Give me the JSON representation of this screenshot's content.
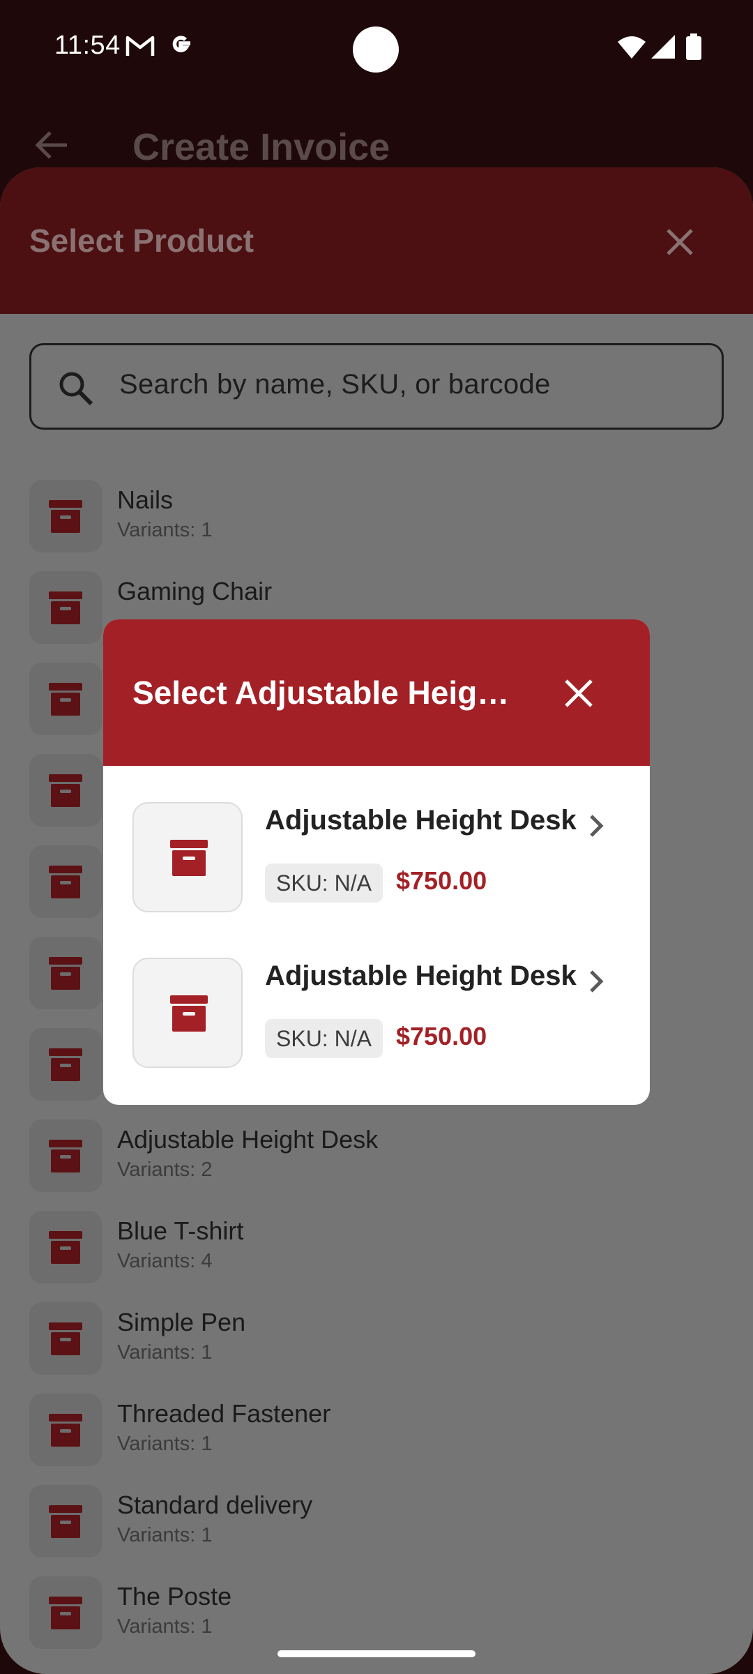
{
  "status_bar": {
    "time": "11:54",
    "icons": [
      "gmail-icon",
      "google-icon",
      "wifi-icon",
      "signal-icon",
      "battery-icon"
    ]
  },
  "app_bar": {
    "title": "Create Invoice",
    "back_icon": "arrow-back-icon"
  },
  "sheet": {
    "title": "Select Product",
    "close_icon": "close-icon",
    "search": {
      "placeholder": "Search by name, SKU, or barcode",
      "value": ""
    },
    "products": [
      {
        "name": "Nails",
        "variants": "Variants: 1"
      },
      {
        "name": "Gaming Chair",
        "variants": ""
      },
      {
        "name": "",
        "variants": ""
      },
      {
        "name": "",
        "variants": ""
      },
      {
        "name": "",
        "variants": ""
      },
      {
        "name": "",
        "variants": ""
      },
      {
        "name": "",
        "variants": ""
      },
      {
        "name": "Adjustable Height Desk",
        "variants": "Variants: 2"
      },
      {
        "name": "Blue T-shirt",
        "variants": "Variants: 4"
      },
      {
        "name": "Simple Pen",
        "variants": "Variants: 1"
      },
      {
        "name": "Threaded Fastener",
        "variants": "Variants: 1"
      },
      {
        "name": "Standard delivery",
        "variants": "Variants: 1"
      },
      {
        "name": "The Poste",
        "variants": "Variants: 1"
      }
    ]
  },
  "dialog": {
    "title": "Select Adjustable Heigh…",
    "close_icon": "close-icon",
    "variants": [
      {
        "name": "Adjustable Height Desk",
        "sku": "SKU: N/A",
        "price": "$750.00"
      },
      {
        "name": "Adjustable Height Desk",
        "sku": "SKU: N/A",
        "price": "$750.00"
      }
    ]
  },
  "colors": {
    "primary": "#a32126",
    "primary_dimmed": "#4c1012",
    "scrim": "#757575",
    "app_background_dimmed": "#1f0809",
    "price": "#a32126"
  }
}
